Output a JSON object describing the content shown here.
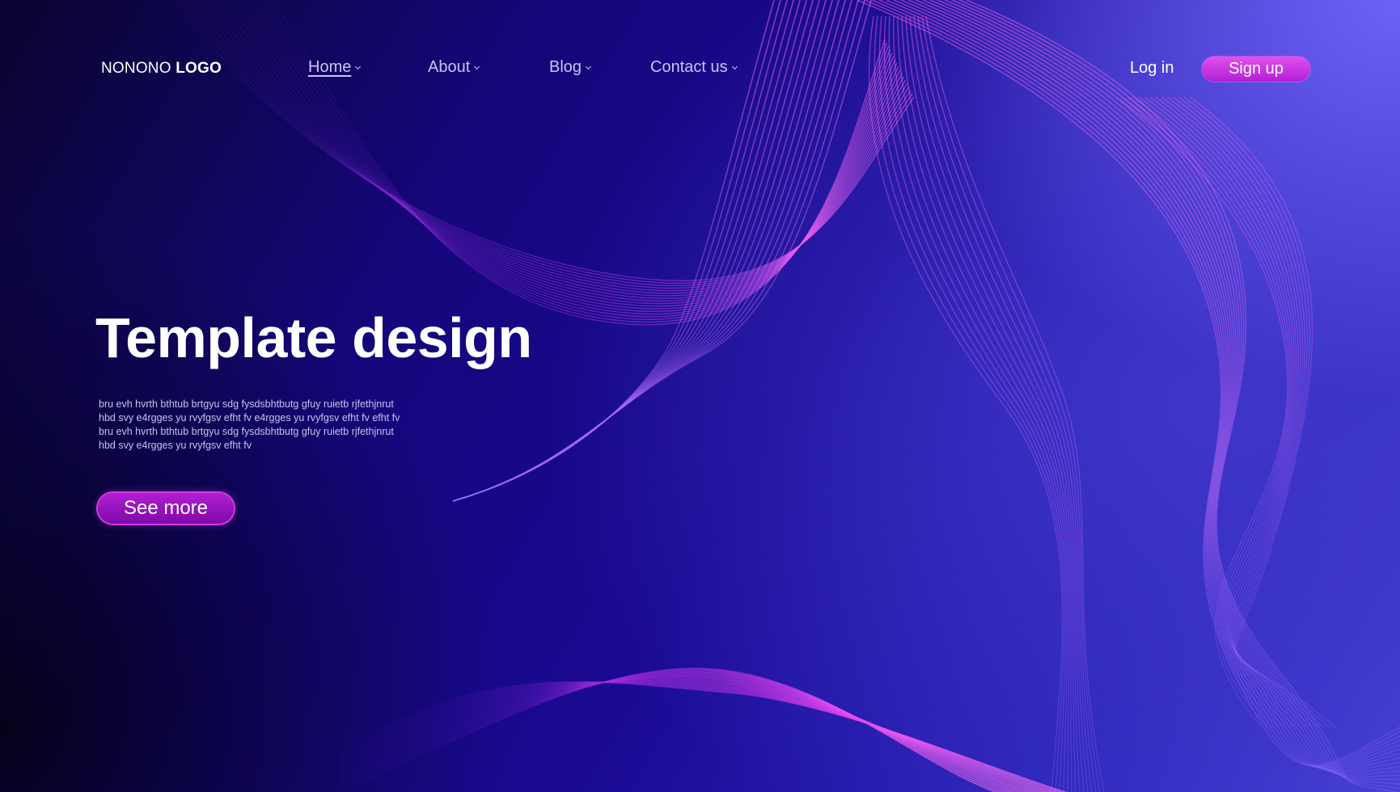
{
  "logo": {
    "regular": "NONONO",
    "bold": "LOGO"
  },
  "nav": {
    "items": [
      {
        "label": "Home",
        "active": true
      },
      {
        "label": "About",
        "active": false
      },
      {
        "label": "Blog",
        "active": false
      },
      {
        "label": "Contact us",
        "active": false
      }
    ]
  },
  "auth": {
    "login_label": "Log in",
    "signup_label": "Sign up"
  },
  "hero": {
    "title": "Template design",
    "body_lines": [
      "bru evh hvrth bthtub brtgyu sdg fysdsbhtbutg gfuy ruietb rjfethjnrut",
      "hbd svy e4rgges yu rvyfgsv efht fv   e4rgges yu rvyfgsv efht fv   efht fv",
      "bru evh hvrth bthtub brtgyu sdg fysdsbhtbutg gfuy ruietb rjfethjnrut",
      "hbd svy e4rgges yu rvyfgsv efht fv"
    ],
    "cta_label": "See more"
  },
  "colors": {
    "background_dark": "#0a0530",
    "background_mid": "#1a0a93",
    "background_light": "#6f63f5",
    "accent_magenta": "#e250ee",
    "accent_purple": "#b01fd0",
    "nav_text": "#c9c4f3"
  }
}
